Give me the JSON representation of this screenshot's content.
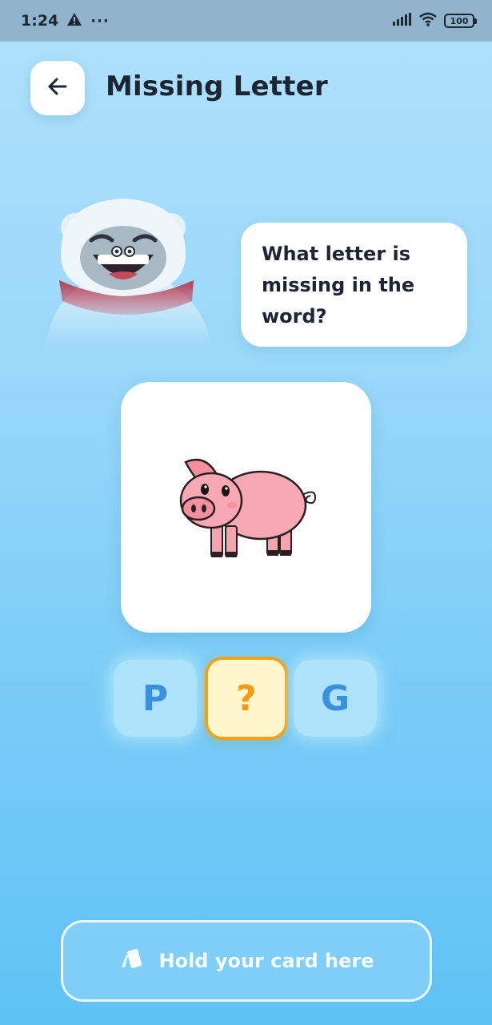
{
  "status_bar": {
    "time": "1:24",
    "more_indicator": "···",
    "battery": "100",
    "icons": [
      "warning-icon",
      "signal-icon",
      "wifi-icon",
      "battery-icon"
    ]
  },
  "header": {
    "back_icon": "arrow-left-icon",
    "title": "Missing Letter"
  },
  "bubble": {
    "line1": "What letter is",
    "line2": "missing in the",
    "line3": "word?"
  },
  "picture": {
    "subject": "pig"
  },
  "word_tiles": [
    {
      "letter": "P",
      "state": "shown"
    },
    {
      "letter": "?",
      "state": "missing"
    },
    {
      "letter": "G",
      "state": "shown"
    }
  ],
  "nfc": {
    "icon": "card-tap-icon",
    "label": "Hold your card here"
  },
  "colors": {
    "accent_blue": "#3a8fe0",
    "missing_orange": "#f39c12",
    "missing_fill": "#fff6cc",
    "title_dark": "#1d2433"
  }
}
